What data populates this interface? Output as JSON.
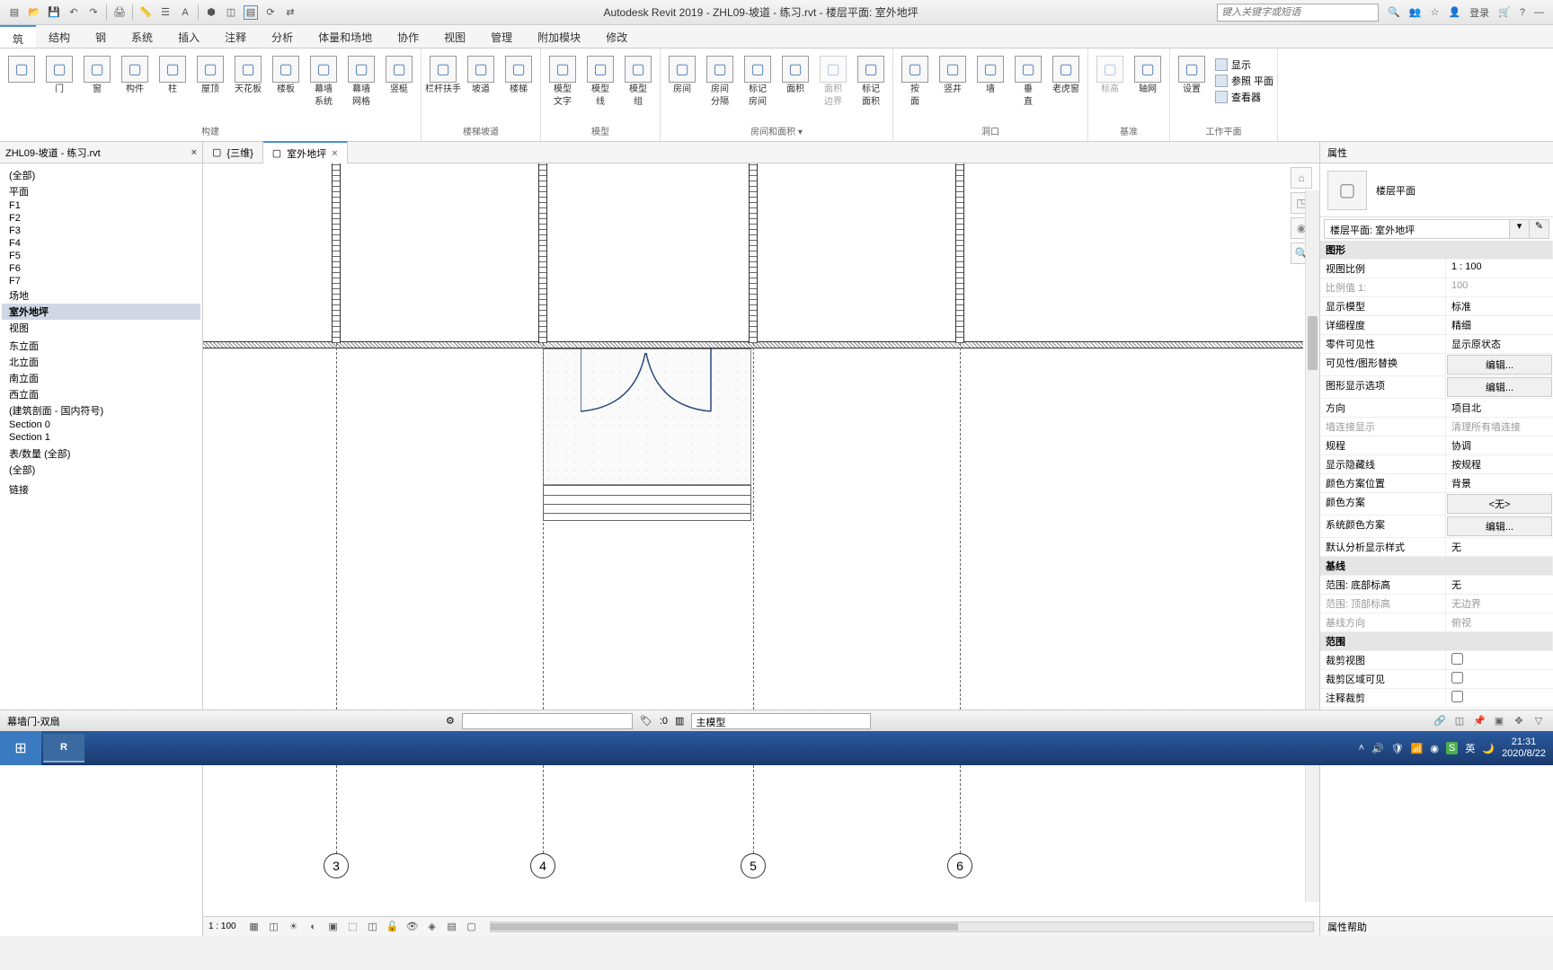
{
  "title": "Autodesk Revit 2019 - ZHL09-坡道 - 练习.rvt - 楼层平面: 室外地坪",
  "search_placeholder": "键入关键字或短语",
  "login": "登录",
  "menus": [
    "筑",
    "结构",
    "钢",
    "系统",
    "插入",
    "注释",
    "分析",
    "体量和场地",
    "协作",
    "视图",
    "管理",
    "附加模块",
    "修改"
  ],
  "ribbon": {
    "groups": [
      {
        "label": "构建",
        "items": [
          "",
          "门",
          "窗",
          "构件",
          "柱",
          "屋顶",
          "天花板",
          "楼板",
          "幕墙\n系统",
          "幕墙\n网格",
          "竖梃"
        ]
      },
      {
        "label": "楼梯坡道",
        "items": [
          "栏杆扶手",
          "坡道",
          "楼梯"
        ]
      },
      {
        "label": "模型",
        "items": [
          "模型\n文字",
          "模型\n线",
          "模型\n组"
        ]
      },
      {
        "label": "房间和面积 ▾",
        "items": [
          "房间",
          "房间\n分隔",
          "标记\n房间",
          "面积",
          "面积\n边界",
          "标记\n面积"
        ]
      },
      {
        "label": "洞口",
        "items": [
          "按\n面",
          "竖井",
          "墙",
          "垂\n直",
          "老虎窗"
        ]
      },
      {
        "label": "基准",
        "items": [
          "标高",
          "轴网"
        ]
      },
      {
        "label": "工作平面",
        "items": [
          "设置"
        ],
        "side": [
          "显示",
          "参照 平面",
          "查看器"
        ]
      }
    ]
  },
  "browser": {
    "file": "ZHL09-坡道 - 练习.rvt",
    "items": [
      "(全部)",
      "平面",
      "F1",
      "F2",
      "F3",
      "F4",
      "F5",
      "F6",
      "F7",
      "场地",
      "室外地坪",
      "视图",
      "",
      "东立面",
      "北立面",
      "南立面",
      "西立面",
      "(建筑剖面 - 国内符号)",
      "Section 0",
      "Section 1",
      "",
      "表/数量 (全部)",
      "(全部)",
      "",
      "",
      "链接"
    ],
    "selected": 10
  },
  "viewtabs": [
    {
      "label": "{三维}",
      "active": false
    },
    {
      "label": "室外地坪",
      "active": true
    }
  ],
  "grids": [
    "3",
    "4",
    "5",
    "6"
  ],
  "scale": "1 : 100",
  "properties": {
    "title": "属性",
    "type_label": "楼层平面",
    "selector": "楼层平面: 室外地坪",
    "edit_type": "编辑 类型",
    "groups": [
      {
        "hdr": "图形",
        "rows": [
          {
            "k": "视图比例",
            "v": "1 : 100"
          },
          {
            "k": "比例值 1:",
            "v": "100",
            "dim": true
          },
          {
            "k": "显示模型",
            "v": "标准"
          },
          {
            "k": "详细程度",
            "v": "精细"
          },
          {
            "k": "零件可见性",
            "v": "显示原状态"
          },
          {
            "k": "可见性/图形替换",
            "v": "编辑...",
            "btn": true
          },
          {
            "k": "图形显示选项",
            "v": "编辑...",
            "btn": true
          },
          {
            "k": "方向",
            "v": "项目北"
          },
          {
            "k": "墙连接显示",
            "v": "清理所有墙连接",
            "dim": true
          },
          {
            "k": "规程",
            "v": "协调"
          },
          {
            "k": "显示隐藏线",
            "v": "按规程"
          },
          {
            "k": "颜色方案位置",
            "v": "背景"
          },
          {
            "k": "颜色方案",
            "v": "<无>",
            "btn": true
          },
          {
            "k": "系统颜色方案",
            "v": "编辑...",
            "btn": true
          },
          {
            "k": "默认分析显示样式",
            "v": "无"
          }
        ]
      },
      {
        "hdr": "基线",
        "rows": [
          {
            "k": "范围: 底部标高",
            "v": "无"
          },
          {
            "k": "范围: 顶部标高",
            "v": "无边界",
            "dim": true
          },
          {
            "k": "基线方向",
            "v": "俯视",
            "dim": true
          }
        ]
      },
      {
        "hdr": "范围",
        "rows": [
          {
            "k": "裁剪视图",
            "v": "",
            "chk": true
          },
          {
            "k": "裁剪区域可见",
            "v": "",
            "chk": true
          },
          {
            "k": "注释裁剪",
            "v": "",
            "chk": true
          }
        ]
      }
    ],
    "help": "属性帮助"
  },
  "status": {
    "selection": "幕墙门-双扇",
    "count": ":0",
    "workset": "主模型"
  },
  "tray": {
    "ime": "英",
    "time": "21:31",
    "date": "2020/8/22"
  }
}
